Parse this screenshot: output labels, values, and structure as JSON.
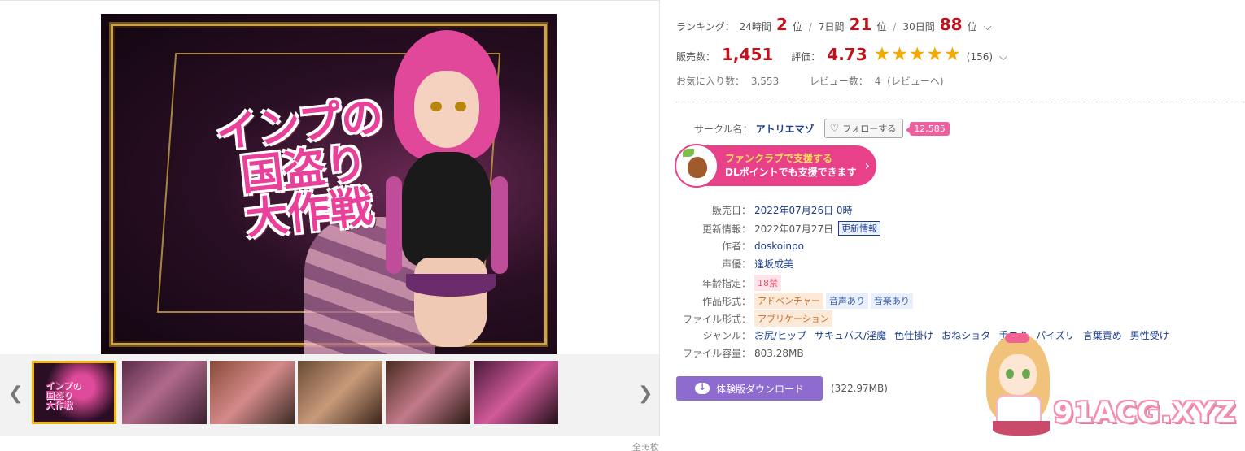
{
  "gallery": {
    "title_art": [
      "インプの",
      "国盗り",
      "大作戦"
    ],
    "thumb_count": "全:6枚"
  },
  "ranking": {
    "label": "ランキング：",
    "d24_label": "24時間",
    "d24_value": "2",
    "d24_unit": "位",
    "sep1": "/",
    "d7_label": "7日間",
    "d7_value": "21",
    "d7_unit": "位",
    "sep2": "/",
    "d30_label": "30日間",
    "d30_value": "88",
    "d30_unit": "位"
  },
  "sales": {
    "label": "販売数：",
    "value": "1,451",
    "rating_label": "評価：",
    "rating_value": "4.73",
    "stars": "★★★★★",
    "rating_count": "(156)"
  },
  "stats": {
    "fav_label": "お気に入り数：",
    "fav_value": "3,553",
    "review_label": "レビュー数：",
    "review_value": "4",
    "review_link": "(レビューへ)"
  },
  "circle": {
    "label": "サークル名：",
    "name": "アトリエマゾ",
    "follow_label": "フォローする",
    "follow_count": "12,585"
  },
  "fanclub": {
    "line1": "ファンクラブで支援する",
    "line2": "DLポイントでも支援できます"
  },
  "spec": {
    "release_k": "販売日：",
    "release_v": "2022年07月26日 0時",
    "update_k": "更新情報：",
    "update_v": "2022年07月27日",
    "update_badge": "更新情報",
    "author_k": "作者：",
    "author_v": "doskoinpo",
    "voice_k": "声優：",
    "voice_v": "逢坂成美",
    "age_k": "年齢指定：",
    "age_v": "18禁",
    "form_k": "作品形式：",
    "form_v": [
      "アドベンチャー",
      "音声あり",
      "音楽あり"
    ],
    "file_k": "ファイル形式：",
    "file_v": "アプリケーション",
    "genre_k": "ジャンル：",
    "genre_v": [
      "お尻/ヒップ",
      "サキュバス/淫魔",
      "色仕掛け",
      "おねショタ",
      "手コキ",
      "パイズリ",
      "言葉責め",
      "男性受け"
    ],
    "size_k": "ファイル容量：",
    "size_v": "803.28MB"
  },
  "download": {
    "label": "体験版ダウンロード",
    "size": "(322.97MB)"
  },
  "watermark": {
    "text": "91ACG.XYZ"
  },
  "colors": {
    "rank_red": "#c0121d",
    "star": "#f2a900",
    "link": "#1a3d8c",
    "fanclub": "#e8418a",
    "download": "#8e6ccf"
  }
}
